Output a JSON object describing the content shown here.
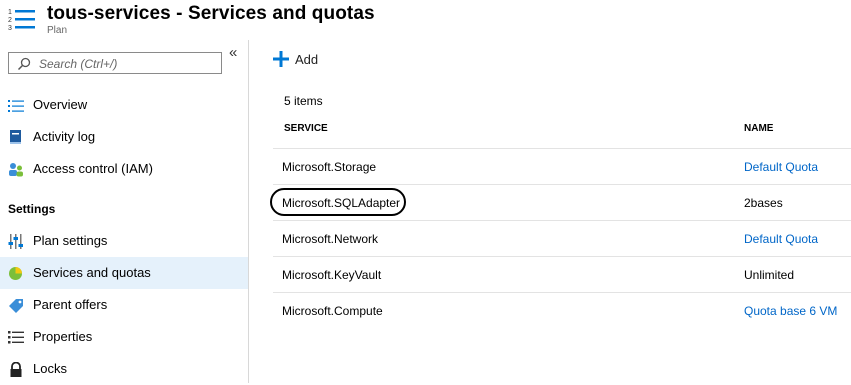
{
  "header": {
    "title": "tous-services - Services and quotas",
    "subtitle": "Plan"
  },
  "sidebar": {
    "collapse_glyph": "«",
    "search": {
      "placeholder": "Search (Ctrl+/)"
    },
    "items": [
      {
        "label": "Overview",
        "icon": "list-icon"
      },
      {
        "label": "Activity log",
        "icon": "book-icon"
      },
      {
        "label": "Access control (IAM)",
        "icon": "people-icon"
      }
    ],
    "section_label": "Settings",
    "settings_items": [
      {
        "label": "Plan settings",
        "icon": "sliders-icon"
      },
      {
        "label": "Services and quotas",
        "icon": "pie-icon",
        "active": true
      },
      {
        "label": "Parent offers",
        "icon": "tag-icon"
      },
      {
        "label": "Properties",
        "icon": "properties-icon"
      },
      {
        "label": "Locks",
        "icon": "lock-icon"
      }
    ]
  },
  "toolbar": {
    "add_label": "Add"
  },
  "table": {
    "count_text": "5 items",
    "columns": [
      "SERVICE",
      "NAME"
    ],
    "rows": [
      {
        "service": "Microsoft.Storage",
        "name": "Default Quota",
        "is_link": true
      },
      {
        "service": "Microsoft.SQLAdapter",
        "name": "2bases",
        "is_link": false,
        "circled": true
      },
      {
        "service": "Microsoft.Network",
        "name": "Default Quota",
        "is_link": true
      },
      {
        "service": "Microsoft.KeyVault",
        "name": "Unlimited",
        "is_link": false
      },
      {
        "service": "Microsoft.Compute",
        "name": "Quota base 6 VM",
        "is_link": true
      }
    ]
  },
  "colors": {
    "link": "#0066c8",
    "active_bg": "#e5f1fb",
    "accent": "#0078d4"
  }
}
